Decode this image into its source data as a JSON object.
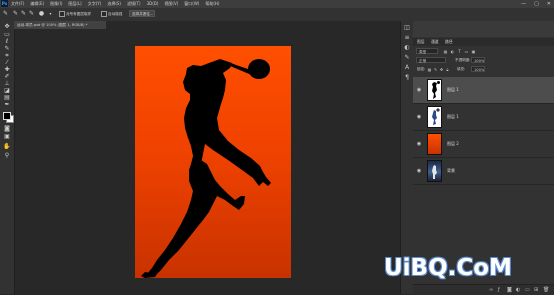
{
  "app": {
    "logo": "Ps",
    "menu": [
      "文件(F)",
      "编辑(E)",
      "图像(I)",
      "图层(L)",
      "文字(Y)",
      "选择(S)",
      "滤镜(T)",
      "3D(D)",
      "视图(V)",
      "窗口(W)",
      "帮助(H)"
    ],
    "window_buttons": [
      "—",
      "▢",
      "✕"
    ]
  },
  "options_bar": {
    "sample_all_layers": "对所有图层取样",
    "auto_enhance": "自动增强",
    "select_and_mask": "选择并遮住..."
  },
  "document": {
    "tab_title": "运动-球员.psd @ 100% (图层 1, RGB/8) *"
  },
  "layers_panel": {
    "tabs": [
      "图层",
      "通道",
      "路径"
    ],
    "kind_filter": "类型",
    "blend_mode": "正常",
    "opacity_label": "不透明度:",
    "opacity_value": "100%",
    "lock_label": "锁定:",
    "fill_label": "填充:",
    "fill_value": "100%",
    "layers": [
      {
        "name": "图层 1",
        "visible": true,
        "selected": true,
        "thumb": "silhouette"
      },
      {
        "name": "图层 1",
        "visible": true,
        "selected": false,
        "thumb": "player"
      },
      {
        "name": "图层 2",
        "visible": true,
        "selected": false,
        "thumb": "gradient"
      },
      {
        "name": "背景",
        "visible": true,
        "selected": false,
        "thumb": "photo",
        "locked": true
      }
    ],
    "footer_icons": [
      "link-icon",
      "fx-icon",
      "mask-icon",
      "adjustment-icon",
      "group-icon",
      "new-layer-icon",
      "trash-icon"
    ]
  },
  "canvas": {
    "gradient_top": "#ff4f00",
    "gradient_bottom": "#c83200",
    "subject": "tennis-player-silhouette"
  },
  "watermark": {
    "text": "UiBQ.CoM",
    "color": "#ffffff",
    "outline": "#5a8bd0"
  },
  "colors": {
    "foreground": "#000000",
    "background": "#ffffff"
  }
}
